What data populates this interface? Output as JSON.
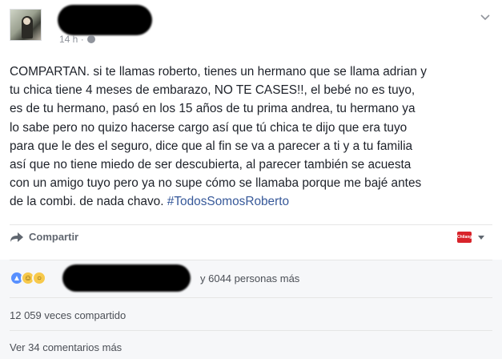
{
  "post": {
    "author_name": "",
    "timestamp": "14 h ·",
    "text_main": "COMPARTAN. si te llamas roberto, tienes un hermano que se llama adrian y\ntu chica tiene 4 meses de embarazo, NO TE CASES!!, el bebé no es tuyo,\nes de tu hermano, pasó en los 15 años de tu prima andrea, tu hermano ya\nlo sabe pero no quizo hacerse cargo así que tú chica te dijo que era tuyo\npara que le des el seguro, dice que al fin se va a parecer a ti y a tu familia\nasí que no tiene miedo de ser descubierta, al parecer también se acuesta\ncon un amigo tuyo pero ya no supe cómo se llamaba porque me bajé antes\nde la combi. de nada chavo. ",
    "hashtag": "#TodosSomosRoberto"
  },
  "actions": {
    "share_label": "Compartir",
    "page_badge": "Chilango"
  },
  "reactions": {
    "others_text": "y 6044 personas más"
  },
  "shares": {
    "count_text": "12 059 veces compartido"
  },
  "comments": {
    "link_text": "Ver 34 comentarios más"
  },
  "colors": {
    "link_blue": "#365899",
    "meta_gray": "#90949c",
    "footer_bg": "#f6f7f9",
    "like_blue": "#5890ff",
    "badge_red": "#d8232a"
  }
}
